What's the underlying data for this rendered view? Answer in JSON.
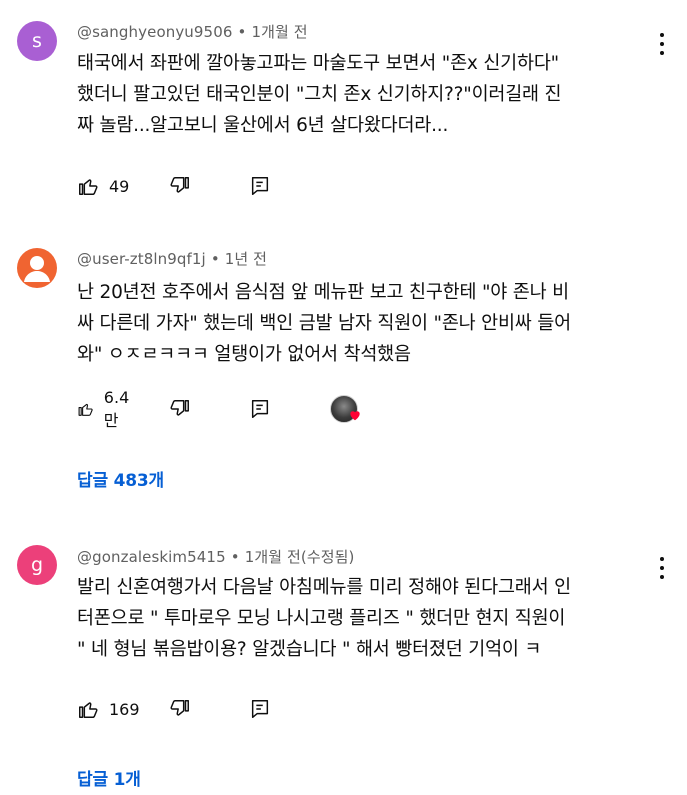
{
  "comments": [
    {
      "avatar_letter": "s",
      "avatar_color": "#a95fd3",
      "username": "@sanghyeonyu9506",
      "time": "1개월 전",
      "lines": [
        "태국에서 좌판에 깔아놓고파는 마술도구 보면서 \"존x 신기하다\"",
        "했더니 팔고있던 태국인분이 \"그치 존x 신기하지??\"이러길래 진",
        "짜 놀람...알고보니 울산에서 6년 살다왔다더라..."
      ],
      "likes": "49"
    },
    {
      "avatar_icon": "person-icon",
      "avatar_color": "#f06431",
      "username": "@user-zt8ln9qf1j",
      "time": "1년 전",
      "lines": [
        "난 20년전 호주에서 음식점 앞 메뉴판 보고 친구한테 \"야 존나 비",
        "싸 다른데 가자\" 했는데 백인 금발 남자 직원이 \"존나 안비싸 들어",
        "와\" ㅇㅈㄹㅋㅋㅋ 얼탱이가 없어서 착석했음"
      ],
      "likes": "6.4만",
      "replies_label": "답글 483개"
    },
    {
      "avatar_letter": "g",
      "avatar_color": "#ec407a",
      "username": "@gonzaleskim5415",
      "time": "1개월 전(수정됨)",
      "lines": [
        "발리 신혼여행가서 다음날 아침메뉴를 미리 정해야 된다그래서 인",
        "터폰으로 \" 투마로우 모닝 나시고랭 플리즈 \" 했더만 현지 직원이",
        "\" 네 형님 볶음밥이용? 알겠습니다 \" 해서 빵터졌던 기억이 ㅋ"
      ],
      "likes": "169",
      "replies_label": "답글 1개"
    }
  ],
  "icons": {
    "like": "thumb-up-icon",
    "dislike": "thumb-down-icon",
    "reply": "reply-icon",
    "menu": "more-vert-icon",
    "creator_heart": "heart-icon"
  },
  "colors": {
    "link_blue": "#065fd4",
    "heart_red": "#ff0033",
    "meta_gray": "#606060"
  }
}
